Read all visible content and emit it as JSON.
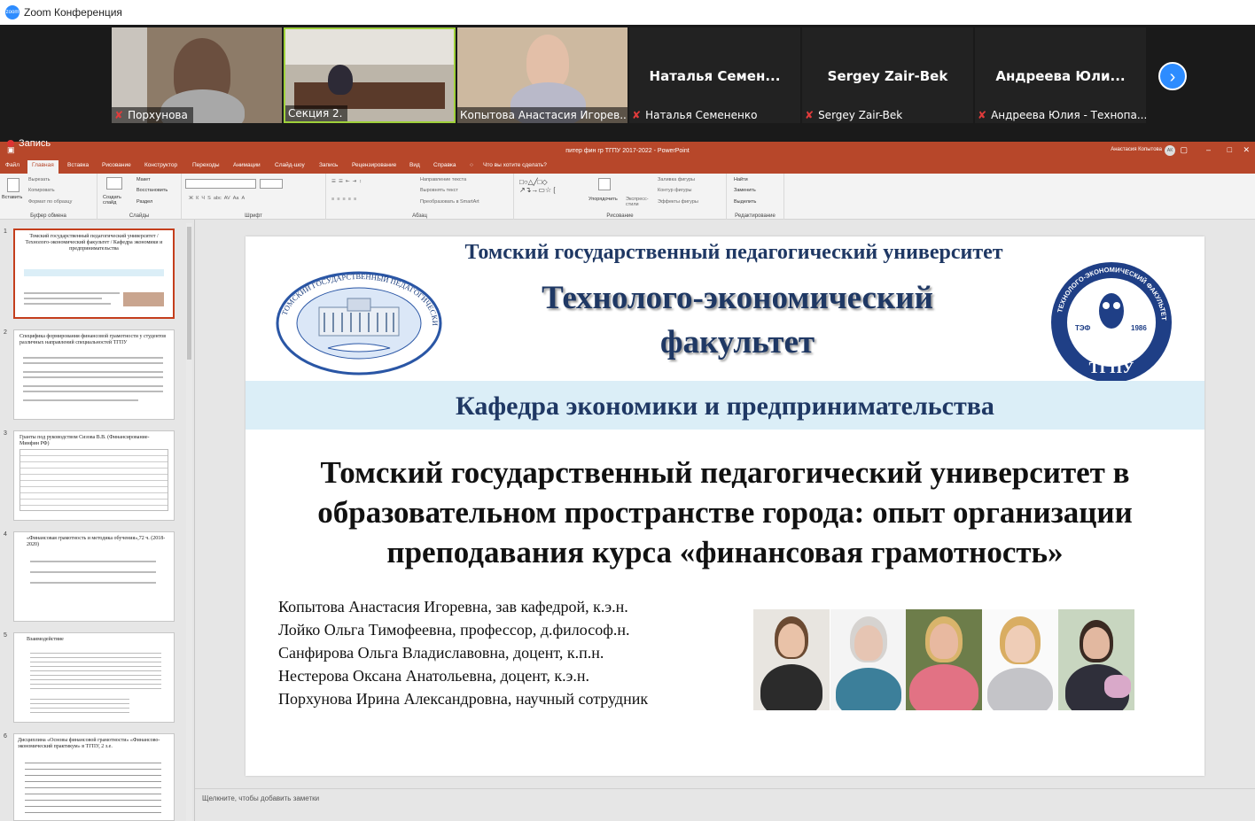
{
  "zoom": {
    "window_title": "Zoom Конференция",
    "recording_label": "Запись",
    "participants": [
      {
        "name": "Порхунова",
        "muted": true,
        "video": true
      },
      {
        "name": "Секция 2.",
        "muted": false,
        "video": true,
        "active_speaker": true
      },
      {
        "name": "Копытова Анастасия Игорев...",
        "muted": false,
        "video": true
      },
      {
        "name": "Наталья Семененко",
        "display_name": "Наталья Семен...",
        "muted": true,
        "video": false
      },
      {
        "name": "Sergey Zair-Bek",
        "display_name": "Sergey Zair-Bek",
        "muted": true,
        "video": false
      },
      {
        "name": "Андреева Юлия - Технопа...",
        "display_name": "Андреева Юли...",
        "muted": true,
        "video": false
      }
    ],
    "next_page_icon": "chevron-right-icon"
  },
  "ppt": {
    "doc_title": "питер фин гр ТГПУ 2017-2022 - PowerPoint",
    "user_name": "Анастасия Копытова",
    "user_initials": "АК",
    "menu": [
      "Файл",
      "Главная",
      "Вставка",
      "Рисование",
      "Конструктор",
      "Переходы",
      "Анимации",
      "Слайд-шоу",
      "Запись",
      "Рецензирование",
      "Вид",
      "Справка",
      "Что вы хотите сделать?"
    ],
    "ribbon": {
      "clipboard": {
        "label": "Буфер обмена",
        "paste": "Вставить",
        "cut": "Вырезать",
        "copy": "Копировать",
        "format": "Формат по образцу"
      },
      "slides": {
        "label": "Слайды",
        "new_slide": "Создать слайд",
        "layout": "Макет",
        "reset": "Восстановить",
        "section": "Раздел"
      },
      "font": {
        "label": "Шрифт"
      },
      "paragraph": {
        "label": "Абзац",
        "text_direction": "Направление текста",
        "align_text": "Выровнять текст",
        "smartart": "Преобразовать в SmartArt"
      },
      "drawing": {
        "label": "Рисование",
        "arrange": "Упорядочить",
        "quick_styles": "Экспресс-стили",
        "fill": "Заливка фигуры",
        "outline": "Контур фигуры",
        "effects": "Эффекты фигуры"
      },
      "editing": {
        "label": "Редактирование",
        "find": "Найти",
        "replace": "Заменить",
        "select": "Выделить"
      }
    },
    "thumbnails": [
      {
        "num": "1",
        "title": "Томский государственный педагогический университет / Технолого-экономический факультет / Кафедра экономики и предпринимательства"
      },
      {
        "num": "2",
        "title": "Специфика формирования финансовой грамотности у студентов различных направлений специальностей ТГПУ"
      },
      {
        "num": "3",
        "title": "Гранты под руководством Сизова В.В. (Финансирование-Минфин РФ)"
      },
      {
        "num": "4",
        "title": "«Финансовая грамотность и методика обучения»,72 ч. (2018-2020)"
      },
      {
        "num": "5",
        "title": "Взаимодействие"
      },
      {
        "num": "6",
        "title": "Дисциплина «Основы финансовой грамотности» «Финансово-экономический практикум» в ТГПУ, 2 з.е."
      }
    ],
    "notes_placeholder": "Щелкните, чтобы добавить заметки"
  },
  "slide": {
    "university": "Томский государственный педагогический университет",
    "faculty_line1": "Технолого-экономический",
    "faculty_line2": "факультет",
    "department": "Кафедра экономики и предпринимательства",
    "talk_title_lines": [
      "Томский государственный педагогический университет в",
      "образовательном пространстве города: опыт организации",
      "преподавания курса «финансовая грамотность»"
    ],
    "authors": [
      "Копытова Анастасия Игоревна, зав кафедрой, к.э.н.",
      "Лойко Ольга Тимофеевна, профессор, д.философ.н.",
      "Санфирова Ольга Владиславовна, доцент, к.п.н.",
      "Нестерова Оксана Анатольевна, доцент, к.э.н.",
      "Порхунова Ирина Александровна, научный сотрудник"
    ],
    "emblem_left_text": "ТОМСКИЙ ГОСУДАРСТВЕННЫЙ ПЕДАГОГИЧЕСКИЙ УНИВЕРСИТЕТ",
    "emblem_right_text": "ТЕХНОЛОГО-ЭКОНОМИЧЕСКИЙ ФАКУЛЬТЕТ",
    "emblem_right_abbr": "ТЭФ",
    "emblem_right_year": "1986",
    "emblem_right_univ": "ТГПУ"
  }
}
